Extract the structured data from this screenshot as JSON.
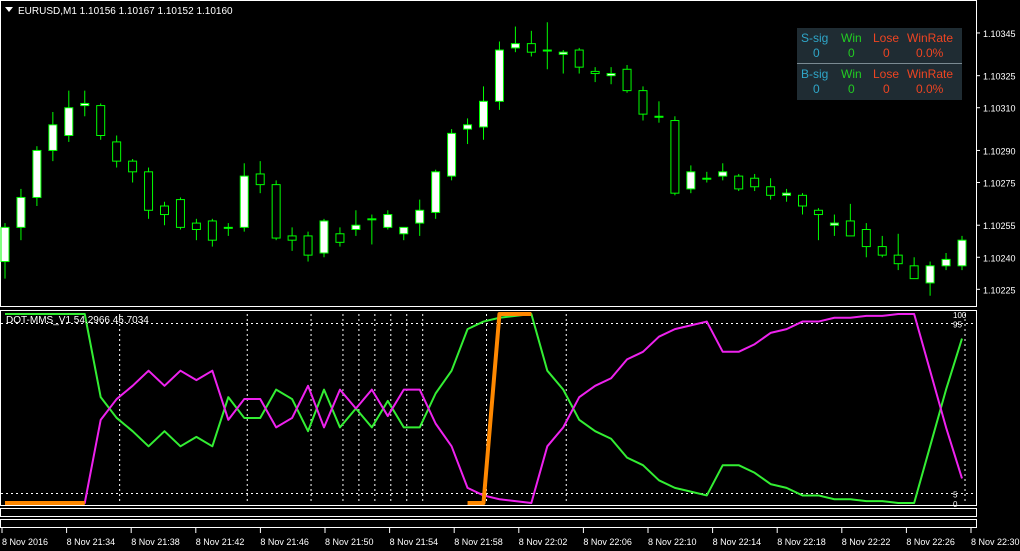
{
  "window": {
    "symbol_header": "EURUSD,M1  1.10156 1.10167 1.10152 1.10160",
    "indicator_header": "DOT-MMS_V1 54.2966 45.7034"
  },
  "colors": {
    "background": "#000000",
    "axis": "#ffffff",
    "grid": "#ffffff",
    "bull_candle": "#ffffff",
    "wick": "#00ff00",
    "line_green": "#33ee33",
    "line_magenta": "#ee22ee",
    "orange_markers": "#ff8800",
    "stats_bg": "#1f2c33",
    "stats_blue": "#2fa6c8",
    "stats_green": "#22cc22",
    "stats_red": "#ee4422"
  },
  "stats_panel": {
    "sell": {
      "label": "S-sig",
      "count": "0",
      "win_label": "Win",
      "win": "0",
      "lose_label": "Lose",
      "lose": "0",
      "rate_label": "WinRate",
      "rate": "0.0%"
    },
    "buy": {
      "label": "B-sig",
      "count": "0",
      "win_label": "Win",
      "win": "0",
      "lose_label": "Lose",
      "lose": "0",
      "rate_label": "WinRate",
      "rate": "0.0%"
    }
  },
  "chart_data": [
    {
      "type": "candlestick",
      "title": "EURUSD,M1  1.10156 1.10167 1.10152 1.10160",
      "ylim": [
        1.1022,
        1.10352
      ],
      "y_ticks": [
        "1.10345",
        "1.10325",
        "1.10310",
        "1.10290",
        "1.10275",
        "1.10255",
        "1.10240",
        "1.10225"
      ],
      "x_ticks": [
        "8 Nov 2016",
        "8 Nov 21:34",
        "8 Nov 21:38",
        "8 Nov 21:42",
        "8 Nov 21:46",
        "8 Nov 21:50",
        "8 Nov 21:54",
        "8 Nov 21:58",
        "8 Nov 22:02",
        "8 Nov 22:06",
        "8 Nov 22:10",
        "8 Nov 22:14",
        "8 Nov 22:18",
        "8 Nov 22:22",
        "8 Nov 22:26",
        "8 Nov 22:30"
      ],
      "candles": [
        {
          "o": 1.10238,
          "h": 1.10256,
          "l": 1.1023,
          "c": 1.10254
        },
        {
          "o": 1.10254,
          "h": 1.10272,
          "l": 1.10248,
          "c": 1.10268
        },
        {
          "o": 1.10268,
          "h": 1.10292,
          "l": 1.10264,
          "c": 1.1029
        },
        {
          "o": 1.1029,
          "h": 1.10308,
          "l": 1.10285,
          "c": 1.10302
        },
        {
          "o": 1.10297,
          "h": 1.10318,
          "l": 1.10294,
          "c": 1.1031
        },
        {
          "o": 1.10311,
          "h": 1.10318,
          "l": 1.10306,
          "c": 1.10312
        },
        {
          "o": 1.10311,
          "h": 1.10312,
          "l": 1.10295,
          "c": 1.10297
        },
        {
          "o": 1.10294,
          "h": 1.10297,
          "l": 1.10282,
          "c": 1.10285
        },
        {
          "o": 1.10285,
          "h": 1.10286,
          "l": 1.10275,
          "c": 1.1028
        },
        {
          "o": 1.1028,
          "h": 1.10282,
          "l": 1.10258,
          "c": 1.10262
        },
        {
          "o": 1.10264,
          "h": 1.10266,
          "l": 1.10255,
          "c": 1.1026
        },
        {
          "o": 1.10267,
          "h": 1.10268,
          "l": 1.10253,
          "c": 1.10254
        },
        {
          "o": 1.10256,
          "h": 1.10258,
          "l": 1.10248,
          "c": 1.10253
        },
        {
          "o": 1.10257,
          "h": 1.10258,
          "l": 1.10245,
          "c": 1.10248
        },
        {
          "o": 1.10254,
          "h": 1.10256,
          "l": 1.1025,
          "c": 1.10254
        },
        {
          "o": 1.10254,
          "h": 1.10284,
          "l": 1.10252,
          "c": 1.10278
        },
        {
          "o": 1.10279,
          "h": 1.10285,
          "l": 1.1027,
          "c": 1.10274
        },
        {
          "o": 1.10274,
          "h": 1.10276,
          "l": 1.10248,
          "c": 1.10249
        },
        {
          "o": 1.1025,
          "h": 1.10254,
          "l": 1.10243,
          "c": 1.10248
        },
        {
          "o": 1.1025,
          "h": 1.10252,
          "l": 1.10238,
          "c": 1.10241
        },
        {
          "o": 1.10242,
          "h": 1.10258,
          "l": 1.1024,
          "c": 1.10257
        },
        {
          "o": 1.10251,
          "h": 1.10254,
          "l": 1.10245,
          "c": 1.10247
        },
        {
          "o": 1.10253,
          "h": 1.10262,
          "l": 1.1025,
          "c": 1.10255
        },
        {
          "o": 1.10258,
          "h": 1.1026,
          "l": 1.10246,
          "c": 1.10258
        },
        {
          "o": 1.10254,
          "h": 1.10262,
          "l": 1.10253,
          "c": 1.1026
        },
        {
          "o": 1.10251,
          "h": 1.10254,
          "l": 1.10248,
          "c": 1.10254
        },
        {
          "o": 1.10256,
          "h": 1.10267,
          "l": 1.1025,
          "c": 1.10262
        },
        {
          "o": 1.10261,
          "h": 1.10281,
          "l": 1.10258,
          "c": 1.1028
        },
        {
          "o": 1.10278,
          "h": 1.103,
          "l": 1.10276,
          "c": 1.10298
        },
        {
          "o": 1.103,
          "h": 1.10305,
          "l": 1.10293,
          "c": 1.10302
        },
        {
          "o": 1.10301,
          "h": 1.1032,
          "l": 1.10295,
          "c": 1.10313
        },
        {
          "o": 1.10313,
          "h": 1.10341,
          "l": 1.10309,
          "c": 1.10337
        },
        {
          "o": 1.10338,
          "h": 1.10348,
          "l": 1.10336,
          "c": 1.1034
        },
        {
          "o": 1.1034,
          "h": 1.10346,
          "l": 1.10334,
          "c": 1.10336
        },
        {
          "o": 1.10337,
          "h": 1.1035,
          "l": 1.10328,
          "c": 1.10337
        },
        {
          "o": 1.10335,
          "h": 1.10337,
          "l": 1.10326,
          "c": 1.10336
        },
        {
          "o": 1.10337,
          "h": 1.10338,
          "l": 1.10326,
          "c": 1.10329
        },
        {
          "o": 1.10327,
          "h": 1.10329,
          "l": 1.10322,
          "c": 1.10326
        },
        {
          "o": 1.10325,
          "h": 1.10329,
          "l": 1.10321,
          "c": 1.10326
        },
        {
          "o": 1.10328,
          "h": 1.1033,
          "l": 1.10317,
          "c": 1.10318
        },
        {
          "o": 1.10318,
          "h": 1.1032,
          "l": 1.10304,
          "c": 1.10307
        },
        {
          "o": 1.10306,
          "h": 1.10313,
          "l": 1.10303,
          "c": 1.10306
        },
        {
          "o": 1.10304,
          "h": 1.10306,
          "l": 1.10269,
          "c": 1.1027
        },
        {
          "o": 1.10272,
          "h": 1.10283,
          "l": 1.1027,
          "c": 1.1028
        },
        {
          "o": 1.10277,
          "h": 1.1028,
          "l": 1.10275,
          "c": 1.10277
        },
        {
          "o": 1.10278,
          "h": 1.10284,
          "l": 1.10276,
          "c": 1.1028
        },
        {
          "o": 1.10278,
          "h": 1.10279,
          "l": 1.10271,
          "c": 1.10272
        },
        {
          "o": 1.10277,
          "h": 1.10279,
          "l": 1.10271,
          "c": 1.10273
        },
        {
          "o": 1.10273,
          "h": 1.10277,
          "l": 1.10267,
          "c": 1.10269
        },
        {
          "o": 1.10269,
          "h": 1.10272,
          "l": 1.10266,
          "c": 1.1027
        },
        {
          "o": 1.10269,
          "h": 1.1027,
          "l": 1.1026,
          "c": 1.10264
        },
        {
          "o": 1.10262,
          "h": 1.10263,
          "l": 1.10248,
          "c": 1.1026
        },
        {
          "o": 1.10255,
          "h": 1.1026,
          "l": 1.1025,
          "c": 1.10256
        },
        {
          "o": 1.10257,
          "h": 1.10265,
          "l": 1.10251,
          "c": 1.1025
        },
        {
          "o": 1.10253,
          "h": 1.10256,
          "l": 1.1024,
          "c": 1.10245
        },
        {
          "o": 1.10245,
          "h": 1.1025,
          "l": 1.1024,
          "c": 1.10241
        },
        {
          "o": 1.10241,
          "h": 1.10251,
          "l": 1.10234,
          "c": 1.10237
        },
        {
          "o": 1.10236,
          "h": 1.1024,
          "l": 1.1023,
          "c": 1.1023
        },
        {
          "o": 1.10228,
          "h": 1.10238,
          "l": 1.10222,
          "c": 1.10236
        },
        {
          "o": 1.10236,
          "h": 1.10242,
          "l": 1.10234,
          "c": 1.10239
        },
        {
          "o": 1.10236,
          "h": 1.1025,
          "l": 1.10234,
          "c": 1.10248
        }
      ]
    },
    {
      "type": "line",
      "title": "DOT-MMS_V1 54.2966 45.7034",
      "ylim": [
        0,
        100
      ],
      "y_ticks": [
        "100",
        "95",
        "5",
        "0"
      ],
      "levels": [
        95,
        5
      ],
      "x_ticks": [
        "8 Nov 2016",
        "8 Nov 21:34",
        "8 Nov 21:38",
        "8 Nov 21:42",
        "8 Nov 21:46",
        "8 Nov 21:50",
        "8 Nov 21:54",
        "8 Nov 21:58",
        "8 Nov 22:02",
        "8 Nov 22:06",
        "8 Nov 22:10",
        "8 Nov 22:14",
        "8 Nov 22:18",
        "8 Nov 22:22",
        "8 Nov 22:26",
        "8 Nov 22:30"
      ],
      "series": [
        {
          "name": "",
          "color": "green",
          "values": [
            100,
            100,
            100,
            100,
            100,
            100,
            56,
            45,
            38,
            30,
            38,
            30,
            35,
            30,
            56,
            45,
            45,
            60,
            55,
            38,
            60,
            40,
            50,
            40,
            54,
            40,
            40,
            58,
            70,
            92,
            96,
            98,
            99,
            100,
            70,
            60,
            44,
            38,
            34,
            24,
            20,
            12,
            8,
            6,
            4,
            20,
            20,
            16,
            10,
            8,
            4,
            4,
            2,
            2,
            1,
            1,
            0,
            0,
            30,
            60,
            87
          ]
        },
        {
          "name": "",
          "color": "magenta",
          "values": [
            0,
            0,
            0,
            0,
            0,
            0,
            44,
            55,
            62,
            70,
            62,
            70,
            65,
            70,
            44,
            55,
            55,
            40,
            45,
            62,
            40,
            60,
            50,
            60,
            46,
            60,
            60,
            42,
            30,
            8,
            4,
            2,
            1,
            0,
            30,
            40,
            56,
            62,
            66,
            76,
            80,
            88,
            92,
            94,
            96,
            80,
            80,
            84,
            90,
            92,
            96,
            96,
            98,
            98,
            99,
            99,
            100,
            100,
            70,
            40,
            13
          ]
        },
        {
          "name": "",
          "color": "orange",
          "values": [
            1,
            1,
            1,
            1,
            1,
            1,
            null,
            null,
            null,
            null,
            null,
            null,
            null,
            null,
            null,
            null,
            null,
            null,
            null,
            null,
            null,
            null,
            null,
            null,
            null,
            null,
            null,
            null,
            null,
            1,
            1,
            1,
            1,
            1,
            null,
            null,
            null,
            null,
            null,
            null,
            null,
            null,
            null,
            null,
            null,
            null,
            null,
            null,
            null,
            null,
            null,
            null,
            null,
            null,
            null,
            null,
            null,
            null,
            null,
            null,
            null
          ]
        }
      ]
    }
  ]
}
